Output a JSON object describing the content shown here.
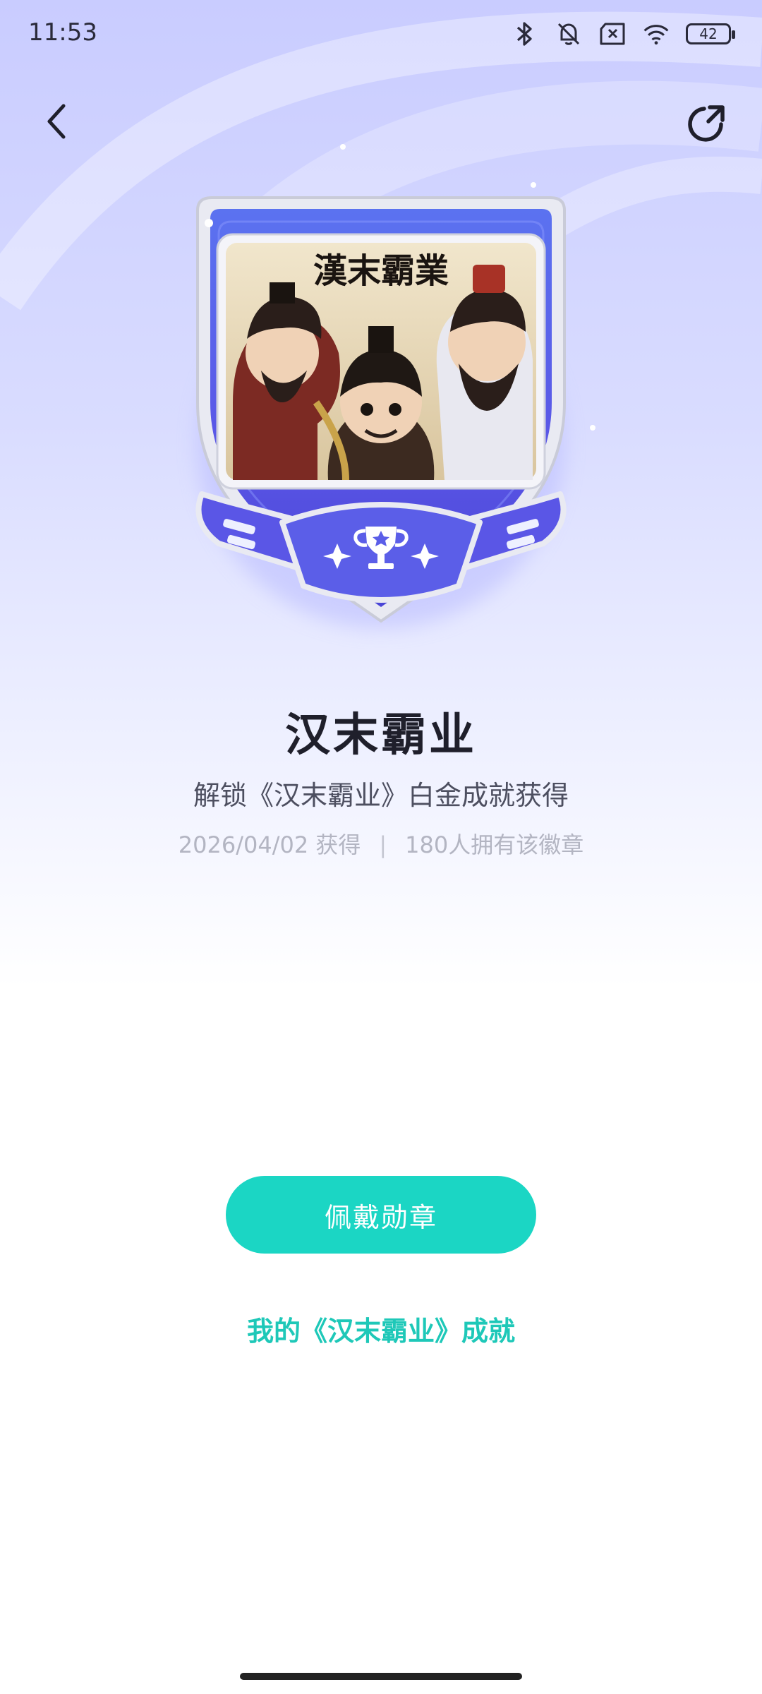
{
  "status_bar": {
    "time": "11:53",
    "battery": "42"
  },
  "nav": {
    "back_icon": "chevron-left-icon",
    "share_icon": "share-arrow-icon"
  },
  "badge": {
    "logo_text": "漢末霸業",
    "trophy_icon": "trophy-icon",
    "colors": {
      "primary": "#5b5ee8",
      "dark": "#4043c9",
      "frame": "#e6e7f0"
    }
  },
  "achievement": {
    "title": "汉末霸业",
    "description": "解锁《汉末霸业》白金成就获得",
    "obtained_date": "2026/04/02 获得",
    "owners": "180人拥有该徽章"
  },
  "actions": {
    "wear_label": "佩戴勋章",
    "my_achievements_link": "我的《汉末霸业》成就"
  },
  "colors": {
    "accent": "#1bd6c4",
    "link": "#1ec8b8"
  }
}
